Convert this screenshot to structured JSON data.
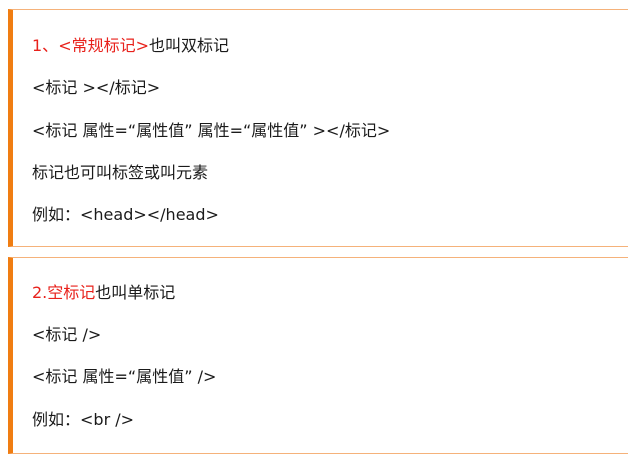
{
  "section1": {
    "heading": {
      "num": "1、",
      "tag": "<常规标记>",
      "rest": "也叫双标记"
    },
    "lines": [
      "<标记 ></标记>",
      "<标记 属性=“属性值” 属性=“属性值” ></标记>",
      "标记也可叫标签或叫元素",
      "例如：<head></head>"
    ]
  },
  "section2": {
    "heading": {
      "tag": "2.空标记",
      "rest": "也叫单标记"
    },
    "lines": [
      "<标记 />",
      "<标记 属性=“属性值” />",
      "例如：<br />"
    ]
  },
  "colors": {
    "accent_border": "#f07d12",
    "highlight_text": "#e8211b"
  }
}
